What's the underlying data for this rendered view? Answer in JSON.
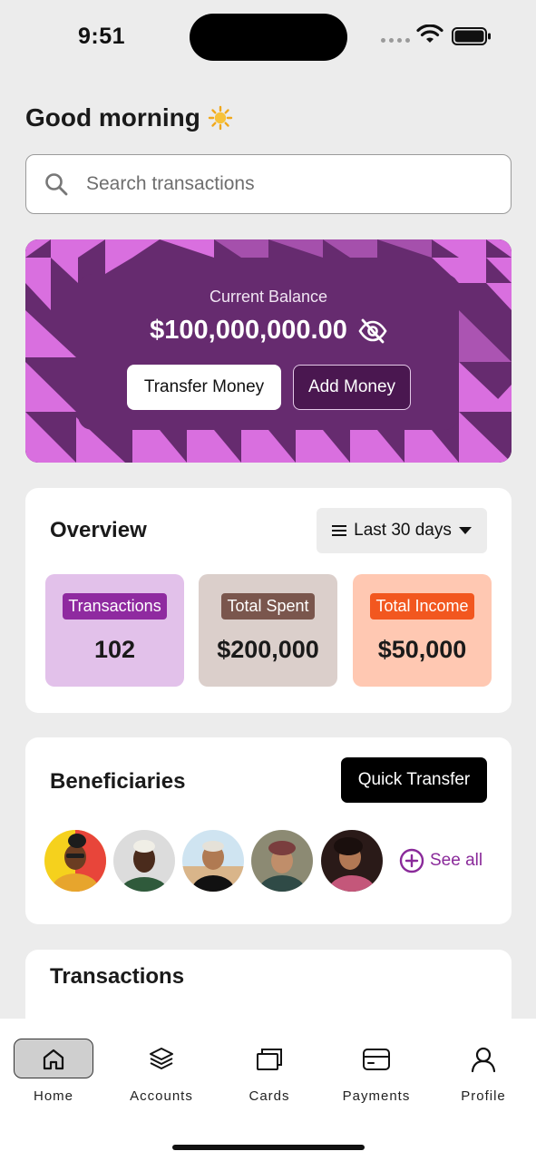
{
  "status_bar": {
    "time": "9:51"
  },
  "greeting": "Good morning",
  "search": {
    "placeholder": "Search transactions"
  },
  "balance_card": {
    "label": "Current Balance",
    "amount": "$100,000,000.00",
    "transfer_label": "Transfer Money",
    "add_label": "Add Money",
    "colors": {
      "background": "#662b6f",
      "pattern": "#d96fdf"
    }
  },
  "overview": {
    "title": "Overview",
    "range_label": "Last 30 days",
    "stats": [
      {
        "label": "Transactions",
        "value": "102",
        "bg": "#e2c1ea",
        "tag": "#8f2aa0"
      },
      {
        "label": "Total Spent",
        "value": "$200,000",
        "bg": "#dbcfcb",
        "tag": "#7a564d"
      },
      {
        "label": "Total Income",
        "value": "$50,000",
        "bg": "#ffc8b2",
        "tag": "#f2571f"
      }
    ]
  },
  "beneficiaries": {
    "title": "Beneficiaries",
    "quick_transfer_label": "Quick Transfer",
    "see_all_label": "See all"
  },
  "transactions": {
    "title": "Transactions"
  },
  "tab_bar": {
    "items": [
      {
        "label": "Home",
        "icon": "home-icon"
      },
      {
        "label": "Accounts",
        "icon": "layers-icon"
      },
      {
        "label": "Cards",
        "icon": "cards-icon"
      },
      {
        "label": "Payments",
        "icon": "payment-card-icon"
      },
      {
        "label": "Profile",
        "icon": "person-icon"
      }
    ],
    "active": "Home"
  }
}
